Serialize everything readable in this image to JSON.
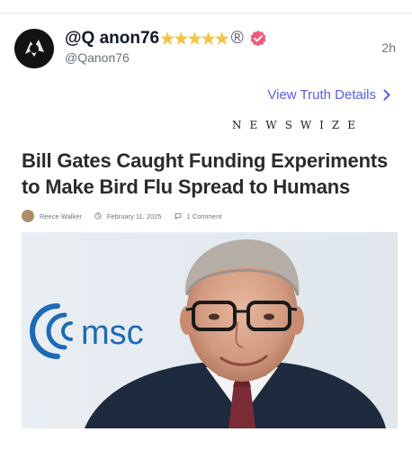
{
  "post": {
    "display_name": "@Q anon76",
    "stars": "★★★★★",
    "registered_mark": "®",
    "handle": "@Qanon76",
    "timestamp": "2h",
    "view_details_label": "View Truth Details"
  },
  "article": {
    "brand": "NEWSWIZE",
    "headline": "Bill Gates Caught Funding Experiments to Make Bird Flu Spread to Humans",
    "author": "Reece Walker",
    "date": "February 11, 2025",
    "comments": "1 Comment",
    "photo_logo_text": "msc"
  },
  "colors": {
    "link": "#5b5ce6",
    "verified": "#ef5a7a",
    "stars": "#f6c343"
  },
  "icons": [
    "avatar-logo-icon",
    "star-icon",
    "verified-badge-icon",
    "chevron-right-icon",
    "clock-icon",
    "comment-icon"
  ]
}
